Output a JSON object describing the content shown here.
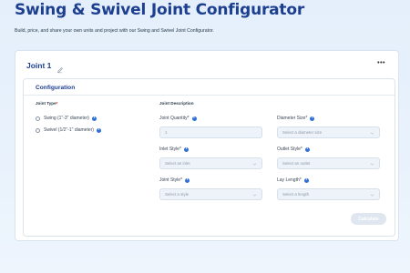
{
  "header": {
    "title": "Swing & Swivel Joint Configurator",
    "subtitle": "Build, price, and share your own units and project with our Swing and Swivel Joint Configurator."
  },
  "joint": {
    "title": "Joint 1",
    "more_label": "•••",
    "configuration_title": "Configuration",
    "joint_type": {
      "label": "Joint Type",
      "required_mark": "*",
      "options": [
        {
          "label": "Swing (1\"-3\" diameter)",
          "info": "i"
        },
        {
          "label": "Swivel (1/2\"-1\" diameter)",
          "info": "i"
        }
      ]
    },
    "description_label": "Joint Description",
    "fields": {
      "quantity": {
        "label": "Joint Quantity*",
        "value": "1"
      },
      "diameter": {
        "label": "Diameter Size*",
        "placeholder": "Select a diameter size"
      },
      "inlet": {
        "label": "Inlet Style*",
        "placeholder": "Select an inlet"
      },
      "outlet": {
        "label": "Outlet Style*",
        "placeholder": "Select an outlet"
      },
      "style": {
        "label": "Joint Style*",
        "placeholder": "Select a style"
      },
      "lay_length": {
        "label": "Lay Length*",
        "placeholder": "Select a length"
      }
    },
    "calculate_label": "Calculate"
  },
  "colors": {
    "brand_blue": "#1d3f8f",
    "info_blue": "#2f6fd6",
    "required_red": "#d9302c",
    "field_bg": "#eef3f9",
    "disabled_button": "#dfe6ef"
  }
}
